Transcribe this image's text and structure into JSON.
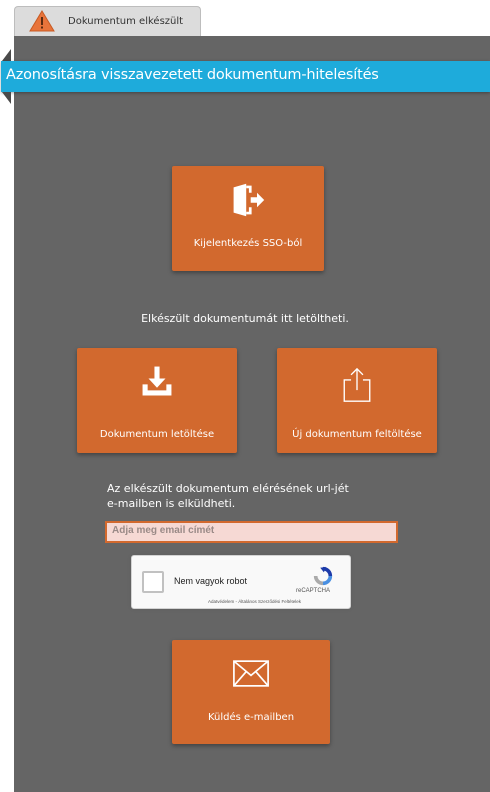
{
  "tab": {
    "label": "Dokumentum elkészült",
    "icon": "warning-icon"
  },
  "header": {
    "title": "Azonosításra visszavezetett dokumentum-hitelesítés"
  },
  "sso_tile": {
    "label": "Kijelentkezés SSO-ból",
    "icon": "logout-door-icon"
  },
  "download_info": "Elkészült dokumentumát itt letöltheti.",
  "download_tile": {
    "label": "Dokumentum letöltése",
    "icon": "download-icon"
  },
  "upload_tile": {
    "label": "Új dokumentum feltöltése",
    "icon": "upload-icon"
  },
  "email_info": {
    "line1": "Az elkészült dokumentum elérésének url-jét",
    "line2": "e-mailben is elküldheti."
  },
  "email_input": {
    "placeholder": "Adja meg email címét",
    "value": ""
  },
  "captcha": {
    "label": "Nem vagyok robot",
    "brand": "reCAPTCHA",
    "links": "Adatvédelem - Általános Szerződési Feltételek"
  },
  "send_tile": {
    "label": "Küldés e-mailben",
    "icon": "mail-icon"
  },
  "colors": {
    "accent": "#d2692e",
    "header": "#1eabdb",
    "panel": "#656565",
    "warning": "#e8743b"
  }
}
